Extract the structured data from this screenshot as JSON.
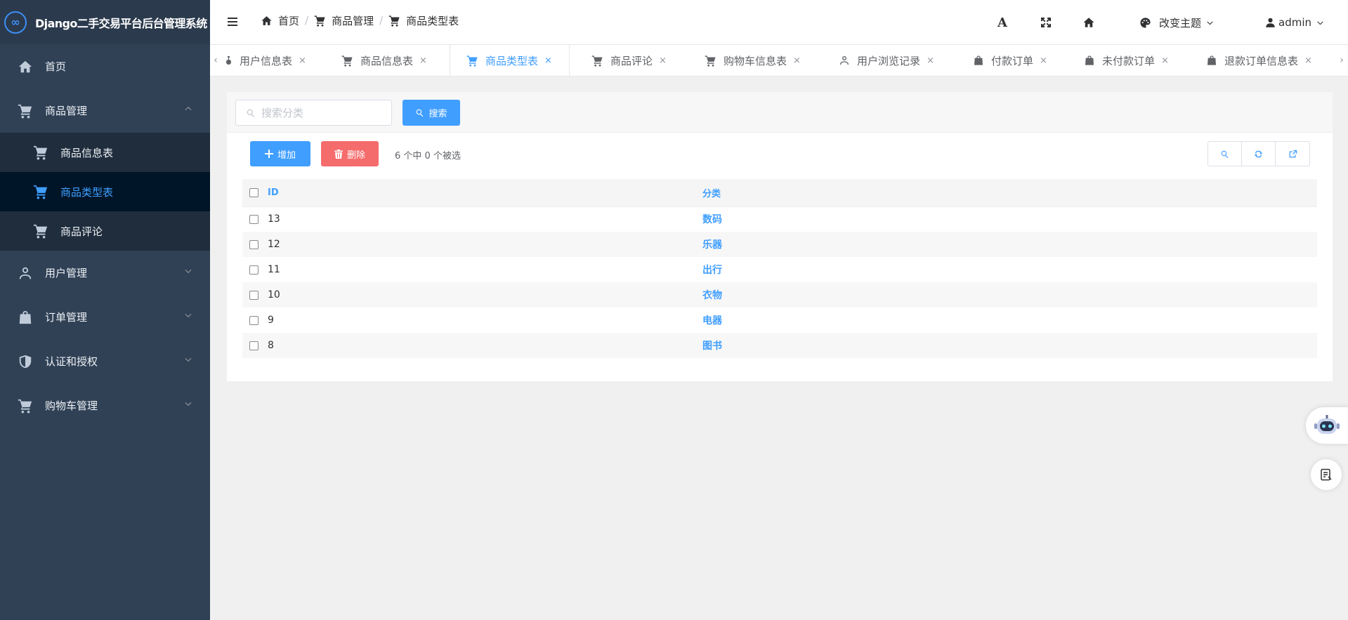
{
  "app": {
    "title": "Django二手交易平台后台管理系统",
    "logo_glyph": "∞"
  },
  "sidebar": {
    "items": [
      {
        "label": "首页",
        "icon": "home-icon"
      },
      {
        "label": "商品管理",
        "icon": "cart-icon",
        "expanded": true,
        "children": [
          {
            "label": "商品信息表",
            "icon": "cart-icon"
          },
          {
            "label": "商品类型表",
            "icon": "cart-icon",
            "active": true
          },
          {
            "label": "商品评论",
            "icon": "cart-icon"
          }
        ]
      },
      {
        "label": "用户管理",
        "icon": "user-icon"
      },
      {
        "label": "订单管理",
        "icon": "bag-icon"
      },
      {
        "label": "认证和授权",
        "icon": "shield-icon"
      },
      {
        "label": "购物车管理",
        "icon": "cart-icon"
      }
    ]
  },
  "header": {
    "breadcrumb": [
      "首页",
      "商品管理",
      "商品类型表"
    ],
    "theme_label": "改变主题",
    "user_label": "admin",
    "font_glyph": "A"
  },
  "tabs": {
    "items": [
      {
        "label": "用户信息表",
        "icon": "key-icon"
      },
      {
        "label": "商品信息表",
        "icon": "cart-icon"
      },
      {
        "label": "商品类型表",
        "icon": "cart-icon",
        "active": true
      },
      {
        "label": "商品评论",
        "icon": "cart-icon"
      },
      {
        "label": "购物车信息表",
        "icon": "cart-icon"
      },
      {
        "label": "用户浏览记录",
        "icon": "user-icon"
      },
      {
        "label": "付款订单",
        "icon": "bag-icon"
      },
      {
        "label": "未付款订单",
        "icon": "bag-icon"
      },
      {
        "label": "退款订单信息表",
        "icon": "bag-icon"
      }
    ],
    "close_glyph": "×",
    "left_arrow": "‹",
    "right_arrow": "›"
  },
  "search": {
    "placeholder": "搜索分类",
    "button_label": "搜索"
  },
  "toolbar": {
    "add_label": "增加",
    "delete_label": "删除",
    "selection_info": "6 个中 0 个被选"
  },
  "table": {
    "headers": [
      "ID",
      "分类"
    ],
    "rows": [
      {
        "id": "13",
        "category": "数码"
      },
      {
        "id": "12",
        "category": "乐器"
      },
      {
        "id": "11",
        "category": "出行"
      },
      {
        "id": "10",
        "category": "衣物"
      },
      {
        "id": "9",
        "category": "电器"
      },
      {
        "id": "8",
        "category": "图书"
      }
    ]
  },
  "colors": {
    "primary": "#409eff",
    "danger": "#f56c6c",
    "sidebar": "#304156",
    "sidebar_active": "#001528"
  }
}
